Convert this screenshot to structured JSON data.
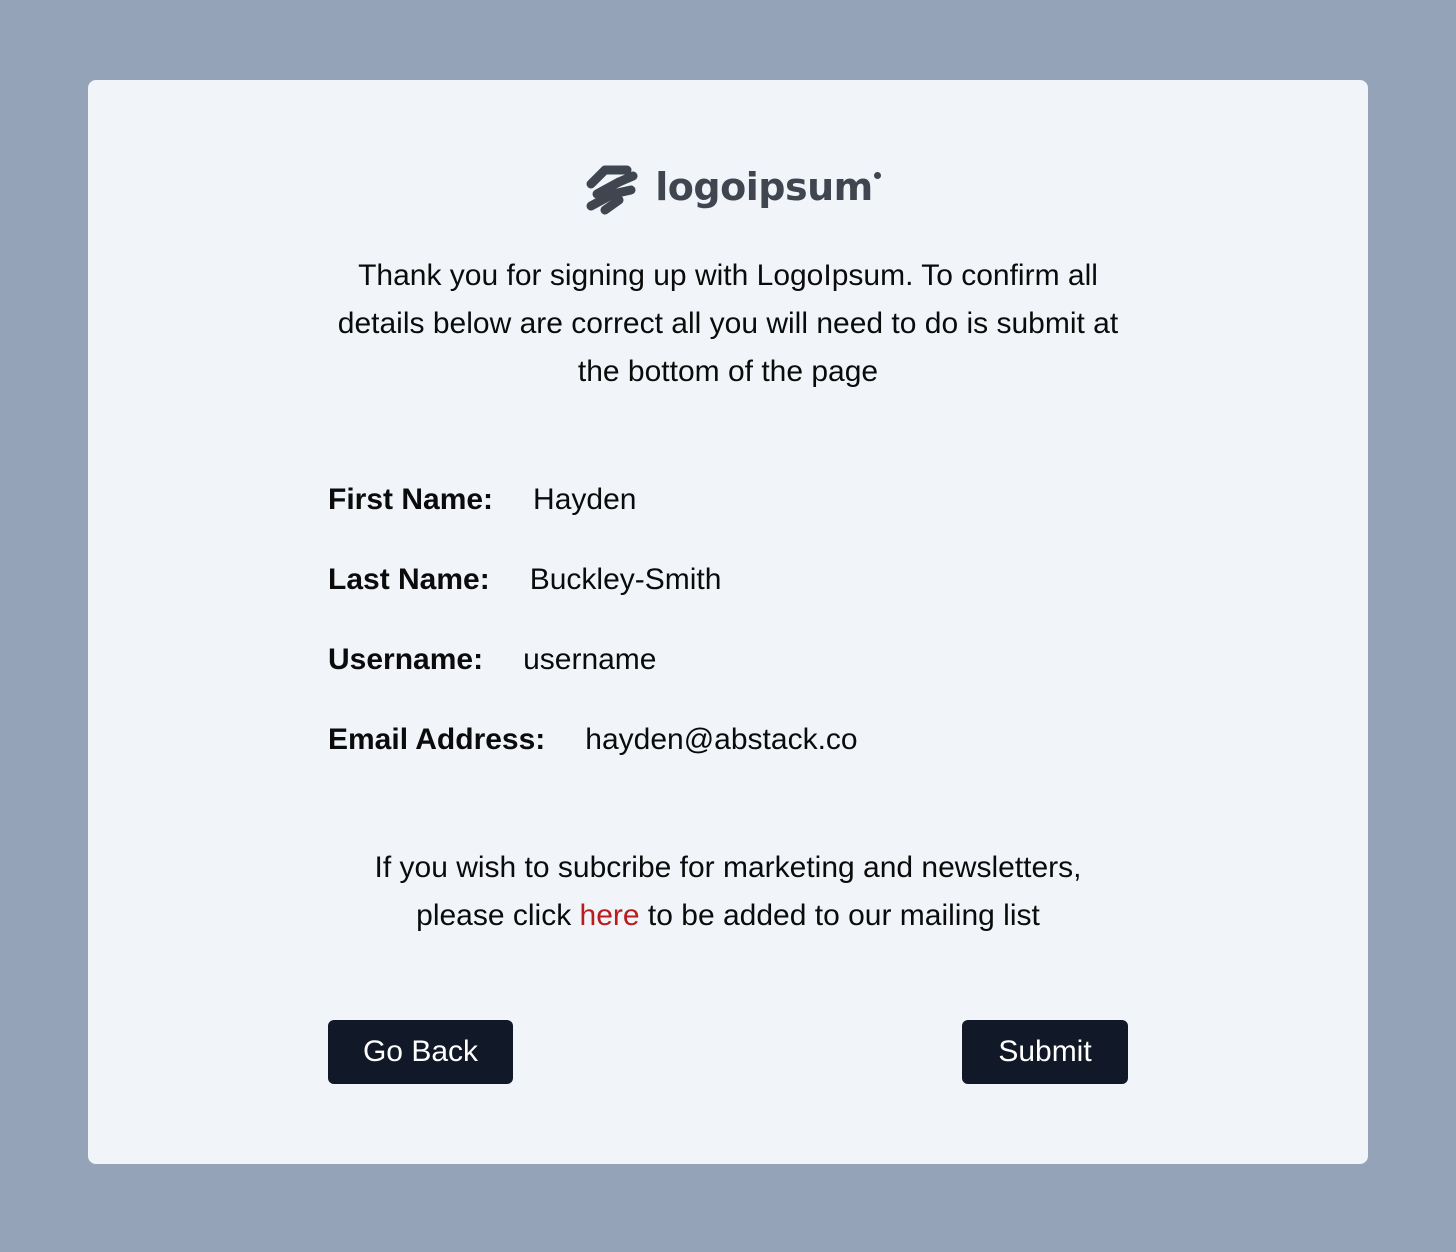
{
  "logo": {
    "text": "logoipsum"
  },
  "intro_text": "Thank you for signing up with LogoIpsum. To confirm all details below are correct all you will need to do is submit at the bottom of the page",
  "details": [
    {
      "label": "First Name:",
      "value": "Hayden"
    },
    {
      "label": "Last Name:",
      "value": "Buckley-Smith"
    },
    {
      "label": "Username:",
      "value": "username"
    },
    {
      "label": "Email Address:",
      "value": "hayden@abstack.co"
    }
  ],
  "marketing": {
    "before": "If you wish to subcribe for marketing and newsletters, please click ",
    "link": "here",
    "after": " to be added to our mailing list"
  },
  "buttons": {
    "back": "Go Back",
    "submit": "Submit"
  },
  "colors": {
    "page_background": "#94a3b8",
    "card_background": "#f1f5f9",
    "button_background": "#111827",
    "link": "#b91c1c",
    "logo": "#3f4650"
  }
}
